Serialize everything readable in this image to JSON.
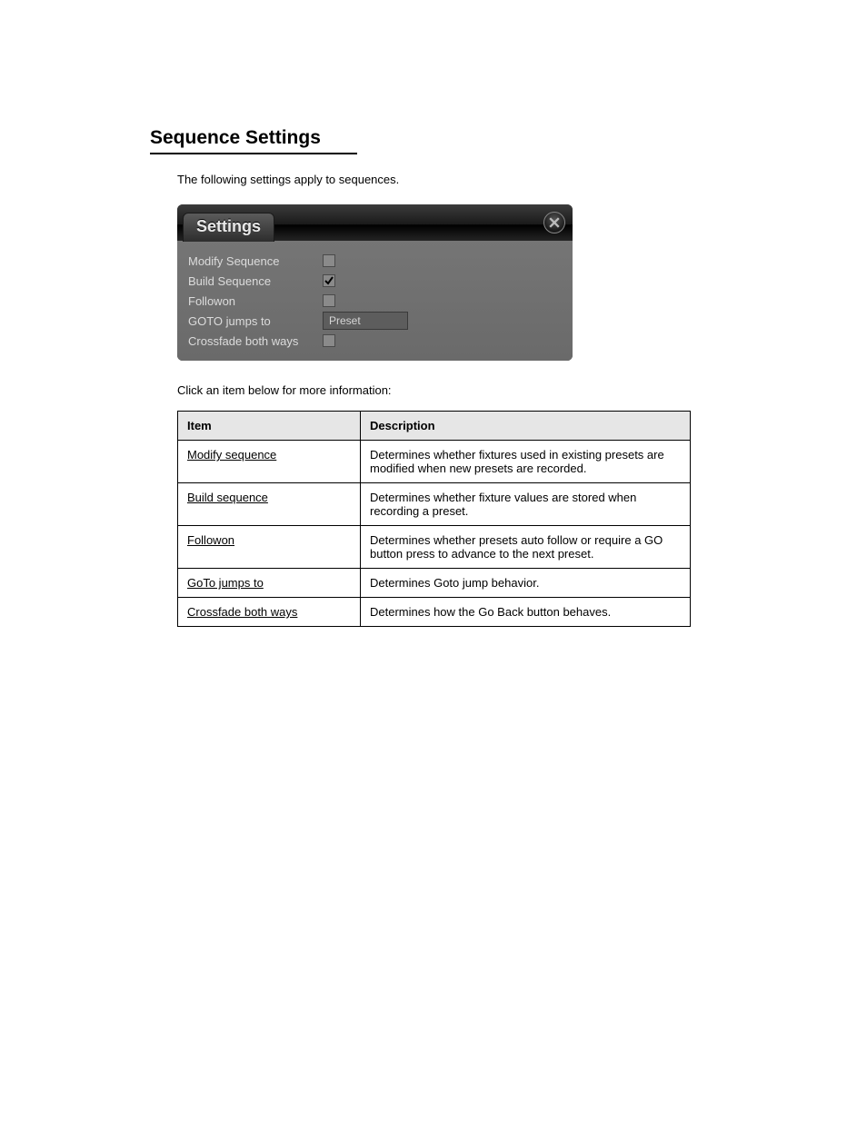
{
  "heading": "Sequence Settings",
  "intro": "The following settings apply to sequences.",
  "panel": {
    "title": "Settings",
    "rows": {
      "modify_sequence": {
        "label": "Modify Sequence",
        "checked": false
      },
      "build_sequence": {
        "label": "Build Sequence",
        "checked": true
      },
      "followon": {
        "label": "Followon",
        "checked": false
      },
      "goto_jumps_to": {
        "label": "GOTO jumps to",
        "value": "Preset"
      },
      "crossfade_both_ways": {
        "label": "Crossfade both ways",
        "checked": false
      }
    }
  },
  "ref_intro": "Click an item below for more information:",
  "ref_table": {
    "headers": {
      "item": "Item",
      "desc": "Description"
    },
    "rows": [
      {
        "item": "Modify sequence",
        "desc": "Determines whether fixtures used in existing presets are modified when new presets are recorded."
      },
      {
        "item": "Build sequence",
        "desc": "Determines whether fixture values are stored when recording a preset."
      },
      {
        "item": "Followon",
        "desc": "Determines whether presets auto follow or require a GO button press to advance to the next preset."
      },
      {
        "item": "GoTo jumps to",
        "desc": "Determines Goto jump behavior."
      },
      {
        "item": "Crossfade both ways",
        "desc": "Determines how the Go Back button behaves."
      }
    ]
  }
}
